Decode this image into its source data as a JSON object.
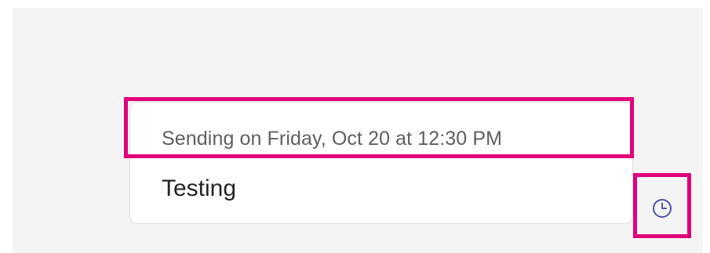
{
  "message": {
    "schedule_text": "Sending on Friday, Oct 20 at 12:30 PM",
    "body": "Testing"
  },
  "schedule_icon": {
    "name": "clock-icon",
    "color": "#4f52b2"
  },
  "highlight_color": "#e0007a"
}
